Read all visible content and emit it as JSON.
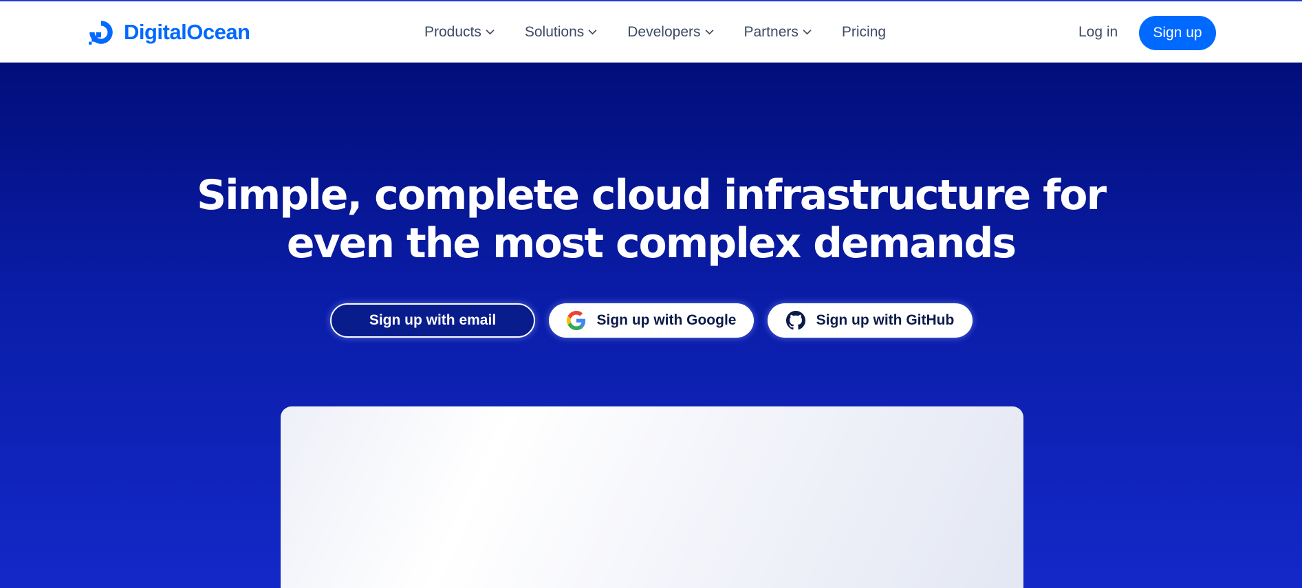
{
  "brand": {
    "name": "DigitalOcean",
    "logo_icon": "digitalocean-logo-icon",
    "color": "#0069ff"
  },
  "nav": {
    "items": [
      {
        "label": "Products",
        "has_dropdown": true
      },
      {
        "label": "Solutions",
        "has_dropdown": true
      },
      {
        "label": "Developers",
        "has_dropdown": true
      },
      {
        "label": "Partners",
        "has_dropdown": true
      },
      {
        "label": "Pricing",
        "has_dropdown": false
      }
    ],
    "login_label": "Log in",
    "signup_label": "Sign up"
  },
  "hero": {
    "headline_line1": "Simple, complete cloud infrastructure for",
    "headline_line2": "even the most complex demands",
    "cta": {
      "email_label": "Sign up with email",
      "google_label": "Sign up with Google",
      "github_label": "Sign up with GitHub"
    },
    "colors": {
      "background_top": "#020e7a",
      "background_bottom": "#1428c9"
    }
  }
}
